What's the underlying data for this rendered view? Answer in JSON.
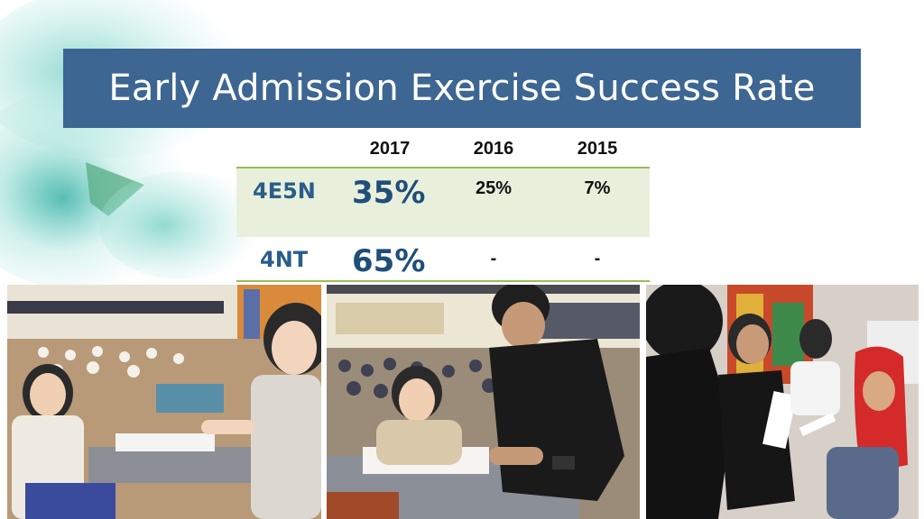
{
  "slide": {
    "title": "Early Admission Exercise Success Rate"
  },
  "table": {
    "years": [
      "2017",
      "2016",
      "2015"
    ],
    "rows": [
      {
        "label": "4E5N",
        "values": [
          "35%",
          "25%",
          "7%"
        ]
      },
      {
        "label": "4NT",
        "values": [
          "65%",
          "-",
          "-"
        ]
      }
    ]
  },
  "colors": {
    "title_bar": "#3d6692",
    "row_highlight": "#e8f0dc",
    "row_rule": "#9bbb59",
    "label_blue": "#2a5d8c",
    "value_blue": "#1f4e79"
  },
  "photos": [
    {
      "name": "photo-students-filling-forms"
    },
    {
      "name": "photo-teacher-assisting-student"
    },
    {
      "name": "photo-students-discussing"
    }
  ]
}
